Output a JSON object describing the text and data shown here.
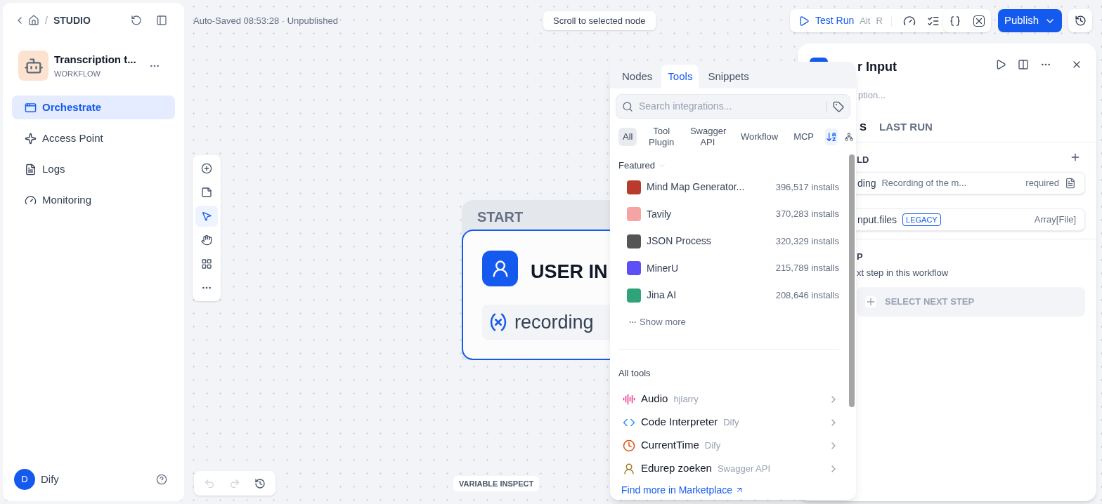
{
  "breadcrumb": {
    "separator": "/",
    "section": "STUDIO"
  },
  "app": {
    "name": "Transcription t...",
    "type": "WORKFLOW"
  },
  "nav": [
    {
      "label": "Orchestrate",
      "selected": true
    },
    {
      "label": "Access Point",
      "selected": false
    },
    {
      "label": "Logs",
      "selected": false
    },
    {
      "label": "Monitoring",
      "selected": false
    }
  ],
  "user": {
    "initial": "D",
    "name": "Dify"
  },
  "canvas": {
    "status": "Auto-Saved 08:53:28 · Unpublished",
    "scroll_hint": "Scroll to selected node",
    "variable_inspect": "VARIABLE INSPECT",
    "tools": [
      {
        "kind": "add",
        "selected": false
      },
      {
        "kind": "note",
        "selected": false
      },
      {
        "kind": "pointer",
        "selected": true
      },
      {
        "kind": "hand",
        "selected": false
      },
      {
        "kind": "blocks",
        "selected": false
      },
      {
        "kind": "more",
        "selected": false
      }
    ],
    "history": [
      {
        "kind": "undo",
        "disabled": true
      },
      {
        "kind": "redo",
        "disabled": true
      },
      {
        "kind": "history",
        "disabled": false
      }
    ],
    "node": {
      "header": "START",
      "title": "USER IN",
      "variable": "recording"
    }
  },
  "toolbar": {
    "test_run": "Test Run",
    "shortcut": [
      "Alt",
      "R"
    ],
    "publish": "Publish"
  },
  "popover": {
    "tabs": [
      {
        "label": "Nodes",
        "selected": false
      },
      {
        "label": "Tools",
        "selected": true
      },
      {
        "label": "Snippets",
        "selected": false
      }
    ],
    "search": {
      "placeholder": "Search integrations..."
    },
    "filters": [
      {
        "label": "All",
        "selected": true
      },
      {
        "label": "Tool Plugin",
        "selected": false
      },
      {
        "label": "Swagger API",
        "selected": false
      },
      {
        "label": "Workflow",
        "selected": false
      },
      {
        "label": "MCP",
        "selected": false
      }
    ],
    "featured": {
      "title": "Featured",
      "show_more": "Show more",
      "items": [
        {
          "name": "Mind Map Generator...",
          "installs": "396,517 installs"
        },
        {
          "name": "Tavily",
          "installs": "370,283 installs"
        },
        {
          "name": "JSON Process",
          "installs": "320,329 installs"
        },
        {
          "name": "MinerU",
          "installs": "215,789 installs"
        },
        {
          "name": "Jina AI",
          "installs": "208,646 installs"
        }
      ]
    },
    "all_tools": {
      "title": "All tools",
      "items": [
        {
          "name": "Audio",
          "author": "hjlarry"
        },
        {
          "name": "Code Interpreter",
          "author": "Dify"
        },
        {
          "name": "CurrentTime",
          "author": "Dify"
        },
        {
          "name": "Edurep zoeken",
          "author": "Swagger API"
        }
      ]
    },
    "marketplace": "Find more in Marketplace"
  },
  "panel": {
    "title": "r Input",
    "description_placeholder": "ption...",
    "tabs": [
      {
        "label": "S",
        "selected": true
      },
      {
        "label": "LAST RUN",
        "selected": false
      }
    ],
    "section": "LD",
    "fields": [
      {
        "kind": "variable",
        "name": "ding",
        "description": "Recording of the m...",
        "badge": "required"
      },
      {
        "kind": "legacy",
        "name": "nput.files",
        "tag": "LEGACY",
        "type": "Array[File]"
      }
    ],
    "next_title": "P",
    "next_hint": "xt step in this workflow",
    "next_button": "SELECT NEXT STEP"
  }
}
